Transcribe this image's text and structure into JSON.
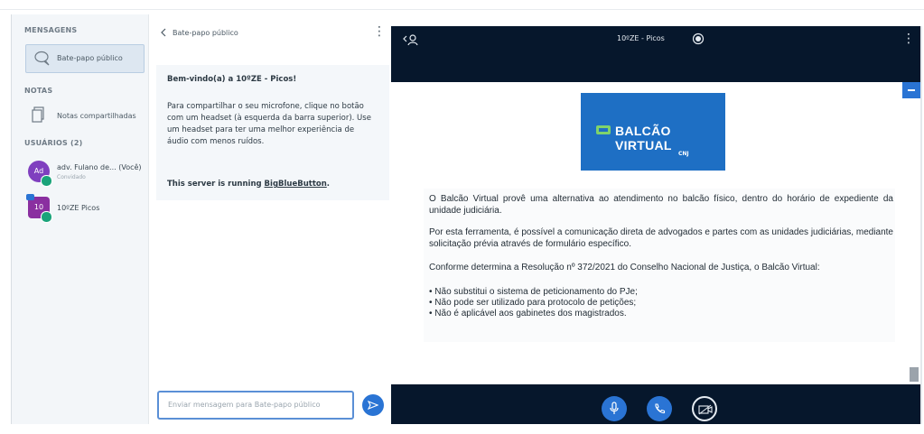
{
  "sidebar": {
    "messages_title": "MENSAGENS",
    "chat_item": "Bate-papo público",
    "notes_title": "NOTAS",
    "notes_item": "Notas compartilhadas",
    "users_title": "USUÁRIOS (2)",
    "users": [
      {
        "avatar": "Ad",
        "name": "adv. Fulano de... (Você)",
        "sub": "Convidado",
        "color": "#7f3fbf"
      },
      {
        "avatar": "10",
        "name": "10ºZE  Picos",
        "sub": "",
        "color": "#8a2fa0"
      }
    ]
  },
  "chat": {
    "header": "Bate-papo público",
    "welcome_title": "Bem-vindo(a) a 10ºZE - Picos!",
    "welcome_text": "Para compartilhar o seu microfone, clique no botão com um headset (à esquerda da barra superior). Use um headset para ter uma melhor experiência de áudio com menos ruídos.",
    "server_prefix": "This server is running ",
    "server_link": "BigBlueButton",
    "server_suffix": ".",
    "input_placeholder": "Enviar mensagem para Bate-papo público"
  },
  "presentation": {
    "title": "10ºZE - Picos",
    "banner_text": "BALCÃO VIRTUAL",
    "banner_logo": "CNJ",
    "para1": "O Balcão Virtual provê uma alternativa ao atendimento no balcão físico, dentro do horário de expediente da unidade judiciária.",
    "para2": "Por esta ferramenta, é possível a comunicação direta de advogados e partes com as unidades judiciárias, mediante solicitação prévia através de formulário específico.",
    "para3": "Conforme determina a Resolução nº 372/2021 do Conselho Nacional de Justiça, o Balcão Virtual:",
    "bullets": [
      "Não substitui o sistema de peticionamento do PJe;",
      "Não pode ser utilizado para protocolo de petições;",
      "Não é aplicável aos gabinetes dos magistrados."
    ]
  },
  "colors": {
    "accent": "#2a74d4",
    "presentation_bg": "#06172c",
    "online": "#1aa37a"
  }
}
